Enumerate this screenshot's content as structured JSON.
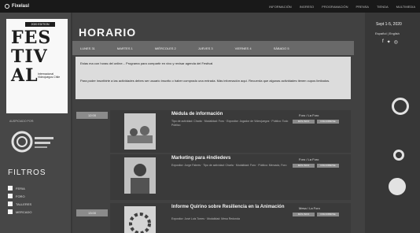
{
  "topbar": {
    "brand": "Fixelasl",
    "nav": [
      "INFORMACIÓN",
      "INGRESO",
      "PROGRAMACIÓN",
      "PRENSA",
      "TIENDA",
      "MULTIMEDIA"
    ]
  },
  "logo": {
    "badge": "2020 EDITION",
    "word": "FES TIV AL",
    "subtitle": "Internacional Videojuegos Chile"
  },
  "sponsor_label": "AUSPICIADO POR:",
  "filters": {
    "title": "FILTROS",
    "items": [
      "FERIA",
      "FORO",
      "TALLERES",
      "MERCADO"
    ]
  },
  "main": {
    "title": "HORARIO",
    "tabs": [
      "LUNES 31",
      "MARTES 1",
      "MIÉRCOLES 2",
      "JUEVES 3",
      "VIERNES 4",
      "SÁBADO 5"
    ],
    "alerts": [
      "Estas ma con horas del online... Programa para compartir en vivo y revisar agenda del Festival",
      "Para poder inscribirte a las actividades debes ser usuario inscrito o haber comprado una entrada. Más información aquí. Recuerda que algunas actividades tienen cupos limitados."
    ]
  },
  "events": [
    {
      "slot": "12:00",
      "title": "Médula de información",
      "meta": "Tipo de actividad: Charla · Modalidad: Foro · Expositor: Jugador de Videojuegos · Público: Todo Público",
      "stage": "Foro / La Foro",
      "btn1": "MÁS INFO",
      "btn2": "INSCRIBIRSE"
    },
    {
      "slot": "",
      "title": "Marketing para #indiedevs",
      "meta": "Expositor: Jorge Fabres · Tipo de actividad: Charla · Modalidad: Foro · Público: Mercado, Foro",
      "stage": "Foro / La Foro",
      "btn1": "MÁS INFO",
      "btn2": "INSCRIBIRSE"
    },
    {
      "slot": "13:00",
      "title": "Informe Quirino sobre Resiliencia en la Animación",
      "meta": "Expositor: José Luis Torres · Modalidad: Mesa Redonda",
      "stage": "Mesa / La Foro",
      "btn1": "MÁS INFO",
      "btn2": "INSCRIBIRSE"
    }
  ],
  "right": {
    "date": "Sept 1-5, 2020",
    "lang": "Español | English",
    "social_icons": [
      "facebook-icon",
      "twitter-icon",
      "instagram-icon"
    ]
  }
}
